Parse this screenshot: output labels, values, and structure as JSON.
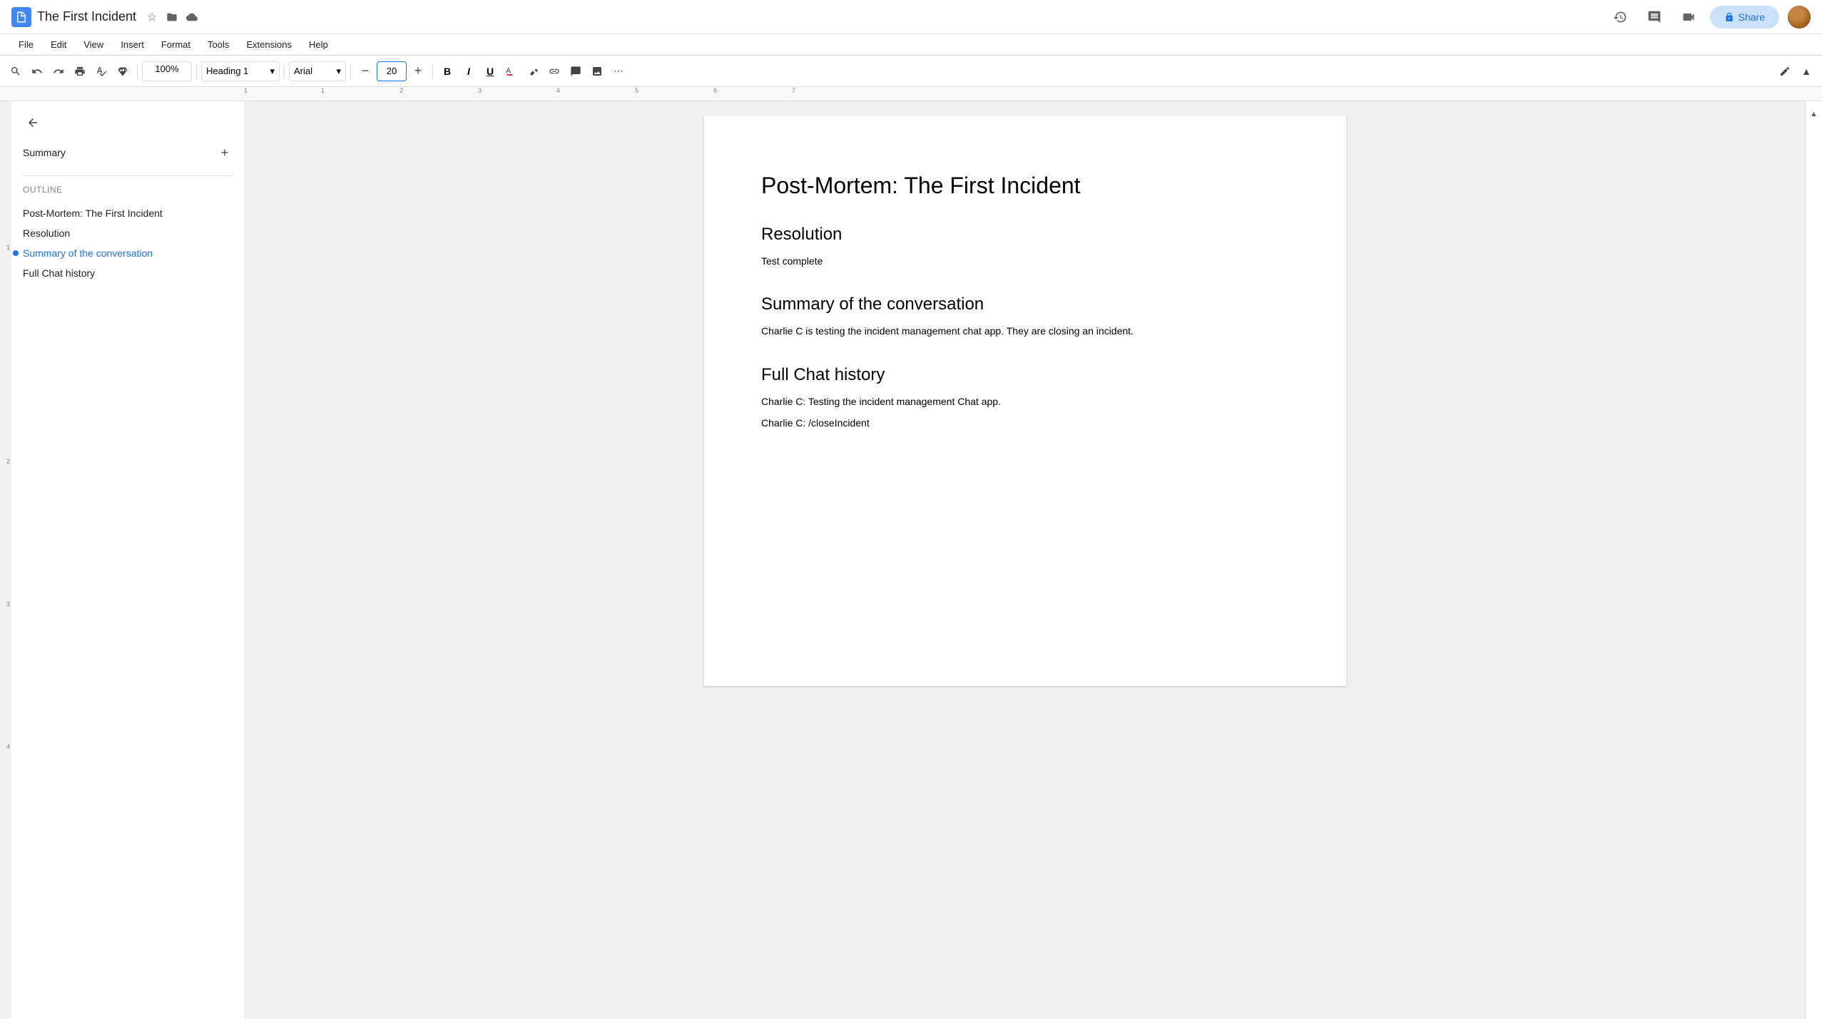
{
  "app": {
    "icon": "D",
    "title": "The First Incident",
    "star_label": "★",
    "folder_icon": "📁",
    "cloud_icon": "☁"
  },
  "menu": {
    "items": [
      "File",
      "Edit",
      "View",
      "Insert",
      "Format",
      "Tools",
      "Extensions",
      "Help"
    ]
  },
  "toolbar": {
    "zoom": "100%",
    "style": "Heading 1",
    "font": "Arial",
    "font_size": "20",
    "bold": "B",
    "italic": "I",
    "underline": "U"
  },
  "header_right": {
    "share_label": "Share"
  },
  "sidebar": {
    "summary_label": "Summary",
    "outline_label": "Outline",
    "back_icon": "←",
    "add_icon": "+",
    "outline_items": [
      {
        "label": "Post-Mortem: The First Incident",
        "active": false
      },
      {
        "label": "Resolution",
        "active": false
      },
      {
        "label": "Summary of the conversation",
        "active": true
      },
      {
        "label": "Full Chat history",
        "active": false
      }
    ]
  },
  "document": {
    "title": "Post-Mortem: The First Incident",
    "sections": [
      {
        "heading": "Resolution",
        "body": "Test complete"
      },
      {
        "heading": "Summary of the conversation",
        "body": "Charlie C is testing the incident management chat app. They are closing an incident."
      },
      {
        "heading": "Full Chat history",
        "body_lines": [
          "Charlie C: Testing the incident management Chat app.",
          "Charlie C: /closeIncident"
        ]
      }
    ]
  }
}
